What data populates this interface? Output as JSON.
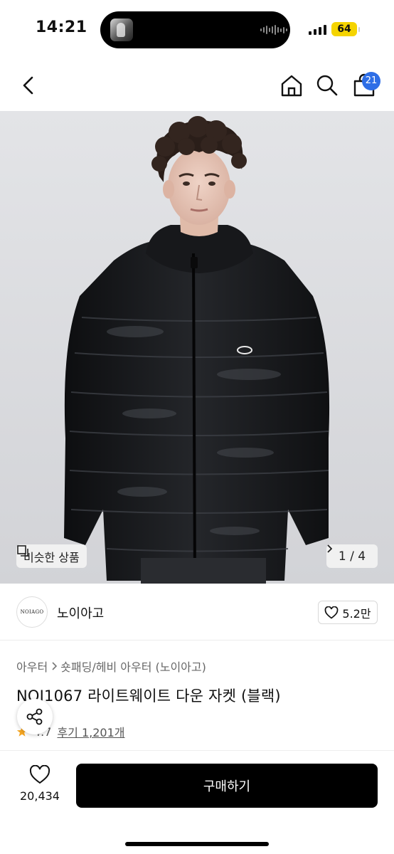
{
  "status_bar": {
    "time": "14:21",
    "battery": "64"
  },
  "nav": {
    "icons": [
      "chevron-left-icon",
      "home-icon",
      "search-icon",
      "cart-icon"
    ],
    "cart_count": "21"
  },
  "hero": {
    "similar_label": "비슷한 상품",
    "page_indicator": "1 / 4",
    "colors": {
      "background": "#dcdde1",
      "jacket": "#16171a"
    }
  },
  "brand": {
    "logo_text": "NOIAGO",
    "name": "노이아고",
    "likes": "5.2만"
  },
  "product": {
    "breadcrumb": [
      "아우터",
      "숏패딩/헤비 아우터 (노이아고)"
    ],
    "title": "NOI1067 라이트웨이트 다운 자켓 (블랙)",
    "rating": "4.7",
    "reviews": "후기 1,201개"
  },
  "bottom_bar": {
    "heart_count": "20,434",
    "buy_label": "구매하기"
  },
  "colors": {
    "accent_badge": "#2e6ee6",
    "battery": "#f5d400",
    "buy_button": "#000000",
    "star": "#f5a623"
  }
}
